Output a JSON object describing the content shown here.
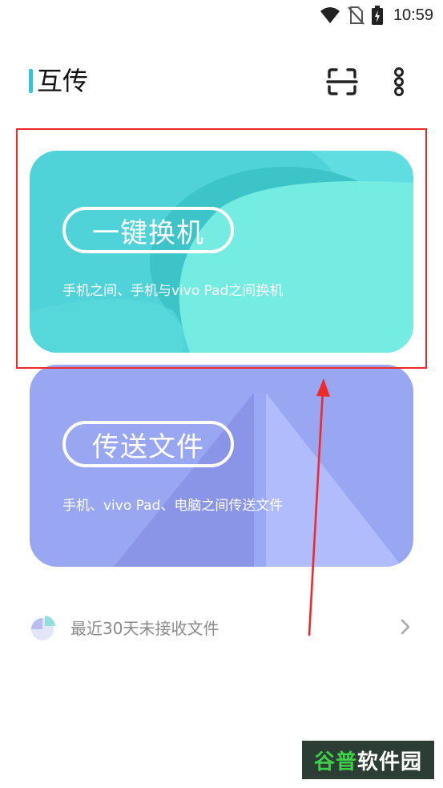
{
  "status_bar": {
    "time": "10:59",
    "icons": [
      "wifi-icon",
      "no-sim-icon",
      "battery-icon"
    ]
  },
  "header": {
    "title": "互传",
    "actions": [
      "scan-icon",
      "more-icon"
    ]
  },
  "cards": {
    "switch": {
      "label": "一键换机",
      "description": "手机之间、手机与vivo Pad之间换机",
      "colors": [
        "#4fd2d8",
        "#75ece2",
        "#3cc4c8"
      ]
    },
    "transfer": {
      "label": "传送文件",
      "description": "手机、vivo Pad、电脑之间传送文件",
      "colors": [
        "#99a6f1",
        "#8a95e8",
        "#b0bcfb"
      ]
    }
  },
  "recent": {
    "label": "最近30天未接收文件",
    "icon": "pie-chart-icon"
  },
  "watermark": {
    "text_part1": "谷普",
    "text_part2": "软件园"
  },
  "colors": {
    "accent": "#33c5dc",
    "annotation_red": "#ee2a2a"
  }
}
